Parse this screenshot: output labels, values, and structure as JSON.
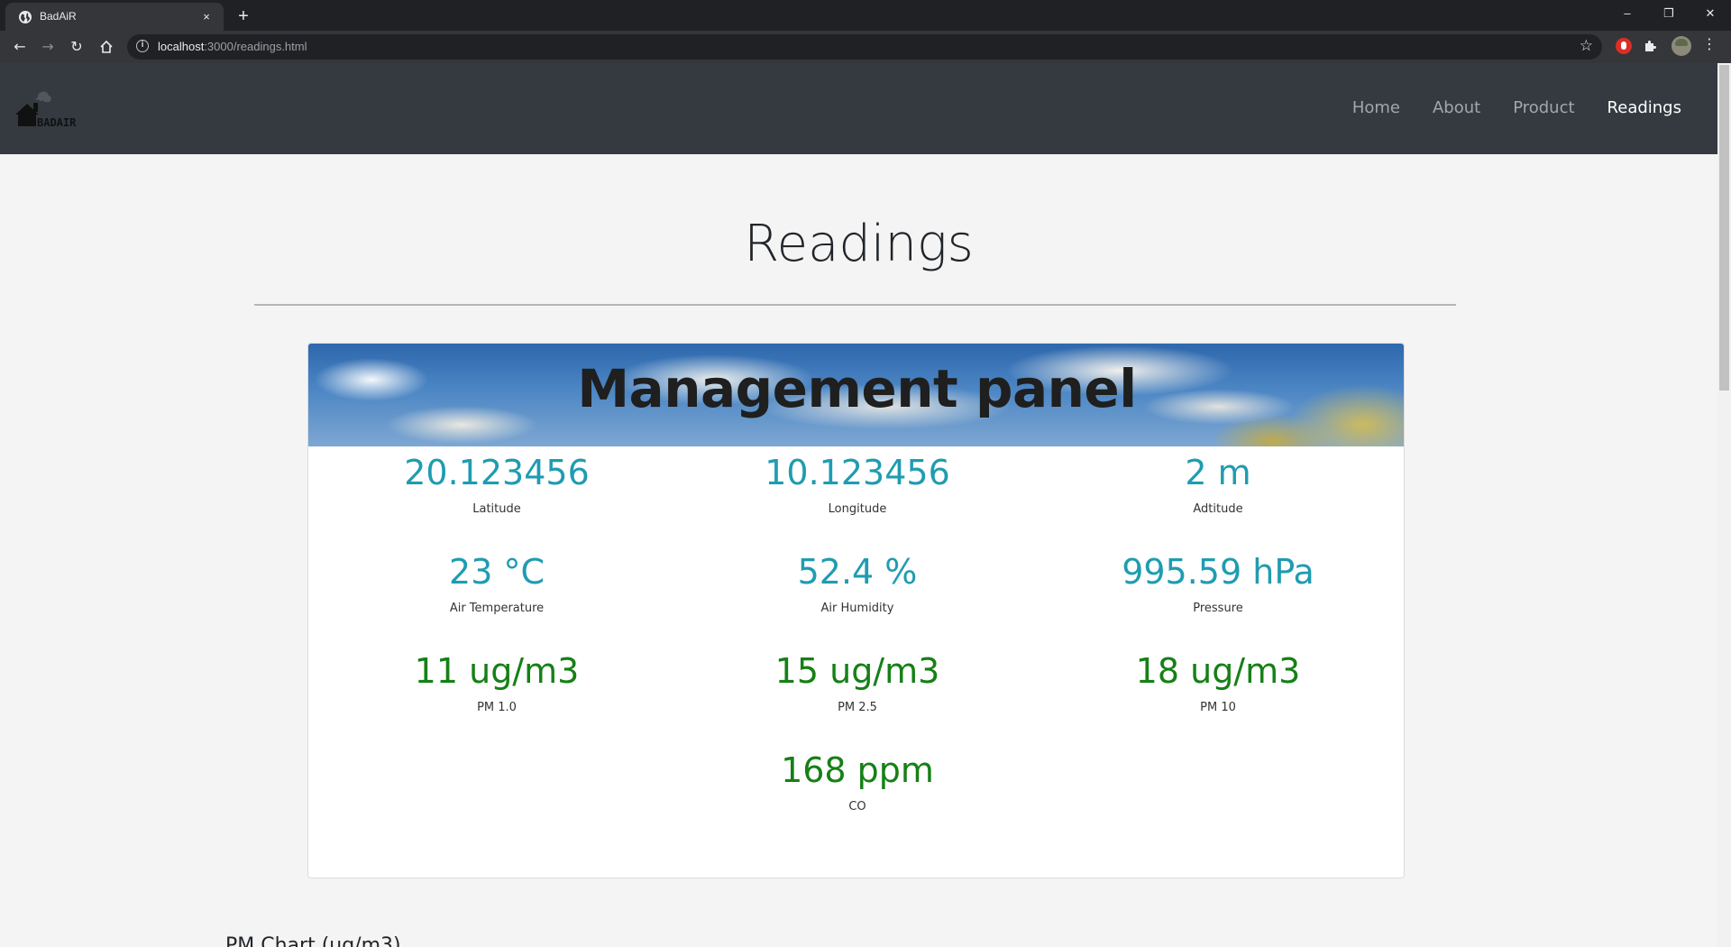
{
  "browser": {
    "tab_title": "BadAiR",
    "tab_close": "×",
    "new_tab": "+",
    "url_host": "localhost",
    "url_rest": ":3000/readings.html",
    "window_controls": {
      "minimize": "–",
      "restore": "❐",
      "close": "✕"
    },
    "icons": [
      "back-icon",
      "forward-icon",
      "reload-icon",
      "home-icon",
      "info-icon",
      "star-icon",
      "puzzle-icon",
      "menu-icon"
    ]
  },
  "navbar": {
    "logo_text": "BADAIR",
    "links": [
      "Home",
      "About",
      "Product",
      "Readings"
    ],
    "active": "Readings"
  },
  "page": {
    "title": "Readings",
    "panel_title": "Management panel",
    "chart_heading": "PM Chart (ug/m3)"
  },
  "readings": [
    {
      "value": "20.123456",
      "label": "Latitude",
      "color": "#1f9cb1"
    },
    {
      "value": "10.123456",
      "label": "Longitude",
      "color": "#1f9cb1"
    },
    {
      "value": "2 m",
      "label": "Adtitude",
      "color": "#1f9cb1"
    },
    {
      "value": "23 °C",
      "label": "Air Temperature",
      "color": "#1f9cb1"
    },
    {
      "value": "52.4 %",
      "label": "Air Humidity",
      "color": "#1f9cb1"
    },
    {
      "value": "995.59 hPa",
      "label": "Pressure",
      "color": "#1f9cb1"
    },
    {
      "value": "11 ug/m3",
      "label": "PM 1.0",
      "color": "#168016"
    },
    {
      "value": "15 ug/m3",
      "label": "PM 2.5",
      "color": "#168016"
    },
    {
      "value": "18 ug/m3",
      "label": "PM 10",
      "color": "#168016"
    },
    {
      "value": "168 ppm",
      "label": "CO",
      "color": "#168016"
    }
  ]
}
